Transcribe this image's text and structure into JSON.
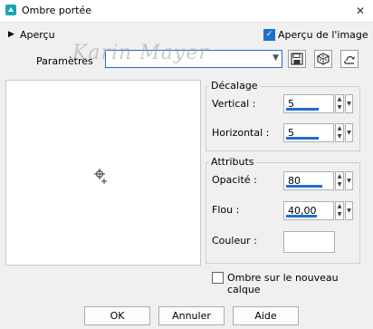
{
  "window": {
    "title": "Ombre portée",
    "close_glyph": "✕"
  },
  "preview_toggle": {
    "label": "Aperçu"
  },
  "image_preview": {
    "label": "Aperçu de l'image",
    "checked": true
  },
  "params": {
    "label": "Paramètres",
    "preset_value": ""
  },
  "watermark": {
    "text": "Karin Mayer"
  },
  "decalage": {
    "title": "Décalage",
    "vertical_label": "Vertical :",
    "vertical_value": "5",
    "horizontal_label": "Horizontal :",
    "horizontal_value": "5"
  },
  "attributs": {
    "title": "Attributs",
    "opacity_label": "Opacité :",
    "opacity_value": "80",
    "blur_label": "Flou :",
    "blur_value": "40,00",
    "color_label": "Couleur :",
    "color_value": "#ffffff"
  },
  "new_layer": {
    "label": "Ombre sur le nouveau calque",
    "checked": false
  },
  "buttons": {
    "ok": "OK",
    "cancel": "Annuler",
    "help": "Aide"
  },
  "colors": {
    "accent": "#1e6fcc",
    "title_icon": "#1aa3b8"
  }
}
